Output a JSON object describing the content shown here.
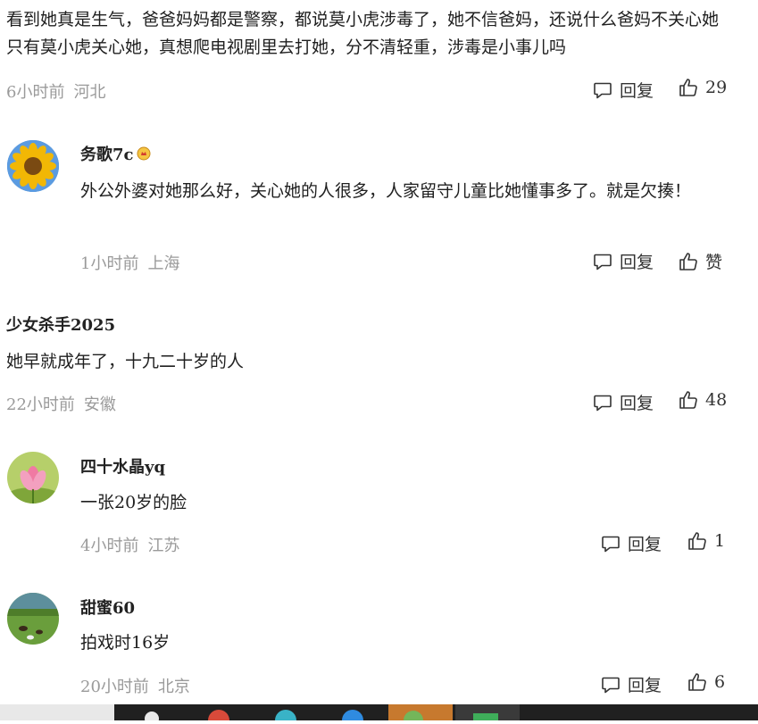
{
  "comments": [
    {
      "text": "看到她真是生气，爸爸妈妈都是警察，都说莫小虎涉毒了，她不信爸妈，还说什么爸妈不关心她只有莫小虎关心她，真想爬电视剧里去打她，分不清轻重，涉毒是小事儿吗",
      "time": "6小时前",
      "location": "河北",
      "reply_label": "回复",
      "like_label": "29"
    },
    {
      "username": "务歌7c",
      "avatar_icon": "sunflower-avatar",
      "text": "外公外婆对她那么好，关心她的人很多，人家留守儿童比她懂事多了。就是欠揍！",
      "time": "1小时前",
      "location": "上海",
      "reply_label": "回复",
      "like_label": "赞"
    },
    {
      "username": "少女杀手2025",
      "text": "她早就成年了，十九二十岁的人",
      "time": "22小时前",
      "location": "安徽",
      "reply_label": "回复",
      "like_label": "48"
    },
    {
      "username": "四十水晶yq",
      "avatar_icon": "lotus-avatar",
      "text": "一张20岁的脸",
      "time": "4小时前",
      "location": "江苏",
      "reply_label": "回复",
      "like_label": "1"
    },
    {
      "username": "甜蜜60",
      "avatar_icon": "grassland-avatar",
      "text": "拍戏时16岁",
      "time": "20小时前",
      "location": "北京",
      "reply_label": "回复",
      "like_label": "6"
    }
  ],
  "colors": {
    "meta": "#9a9a9a",
    "text": "#1f1f1f",
    "taskbar": "#202020"
  }
}
